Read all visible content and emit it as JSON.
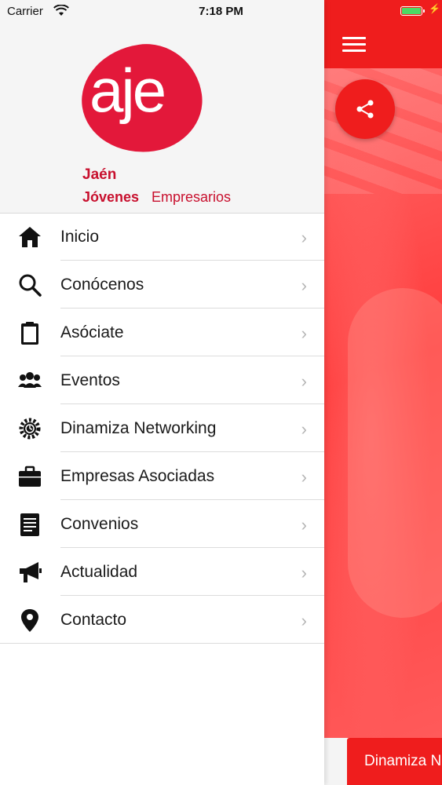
{
  "status_bar": {
    "carrier": "Carrier",
    "time": "7:18 PM"
  },
  "logo": {
    "mark": "aje",
    "city": "Jaén",
    "line_bold": "Jóvenes",
    "line_regular": "Empresarios"
  },
  "menu": {
    "items": [
      {
        "label": "Inicio",
        "icon": "home-icon"
      },
      {
        "label": "Conócenos",
        "icon": "search-icon"
      },
      {
        "label": "Asóciate",
        "icon": "clipboard-icon"
      },
      {
        "label": "Eventos",
        "icon": "people-icon"
      },
      {
        "label": "Dinamiza Networking",
        "icon": "gear-icon"
      },
      {
        "label": "Empresas Asociadas",
        "icon": "briefcase-icon"
      },
      {
        "label": "Convenios",
        "icon": "document-icon"
      },
      {
        "label": "Actualidad",
        "icon": "megaphone-icon"
      },
      {
        "label": "Contacto",
        "icon": "location-pin-icon"
      }
    ],
    "chevron": "›"
  },
  "app": {
    "bottom_button": "Dinamiza Networking"
  },
  "colors": {
    "accent": "#ef1d1d",
    "logo_red": "#c8102e"
  }
}
